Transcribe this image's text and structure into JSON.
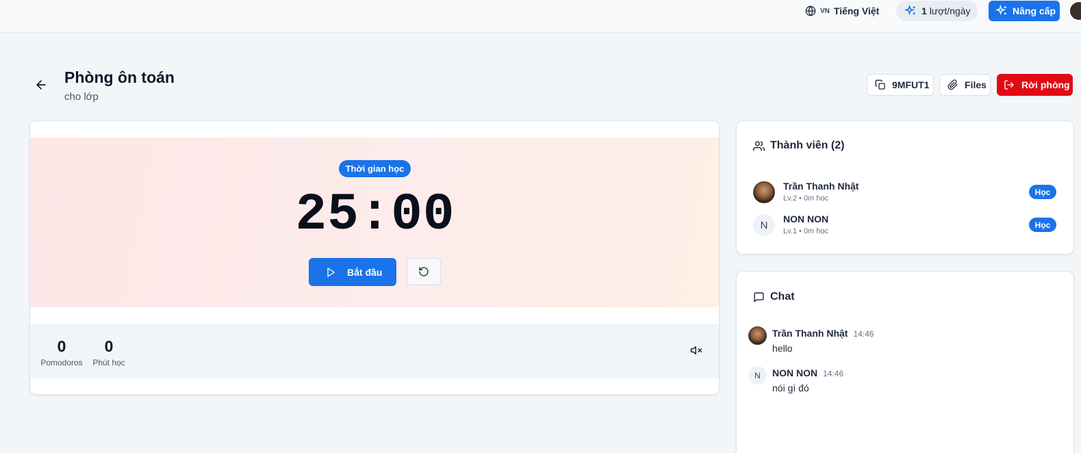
{
  "topbar": {
    "language_code": "VN",
    "language_name": "Tiếng Việt",
    "quota_count": "1",
    "quota_unit": "lượt/ngày",
    "upgrade_label": "Nâng cấp"
  },
  "room": {
    "title": "Phòng ôn toán",
    "subtitle": "cho lớp",
    "code": "9MFUT1",
    "files_label": "Files",
    "leave_label": "Rời phòng"
  },
  "timer": {
    "phase": "Thời gian học",
    "time": "25:00",
    "start_label": "Bắt đầu",
    "stats": [
      {
        "value": "0",
        "label": "Pomodoros"
      },
      {
        "value": "0",
        "label": "Phút học"
      }
    ]
  },
  "members": {
    "title": "Thành viên (2)",
    "list": [
      {
        "name": "Trần Thanh Nhật",
        "meta": "Lv.2 • 0m học",
        "status": "Học",
        "avatar": "photo"
      },
      {
        "name": "NON NON",
        "meta": "Lv.1 • 0m học",
        "status": "Học",
        "avatar": "N"
      }
    ]
  },
  "chat": {
    "title": "Chat",
    "messages": [
      {
        "name": "Trần Thanh Nhật",
        "time": "14:46",
        "text": "hello",
        "avatar": "photo"
      },
      {
        "name": "NON NON",
        "time": "14:46",
        "text": "nói gì đó",
        "avatar": "N"
      }
    ]
  },
  "colors": {
    "primary": "#1a73e8",
    "danger": "#e10a14",
    "timer_bg": "#fde9e8"
  }
}
